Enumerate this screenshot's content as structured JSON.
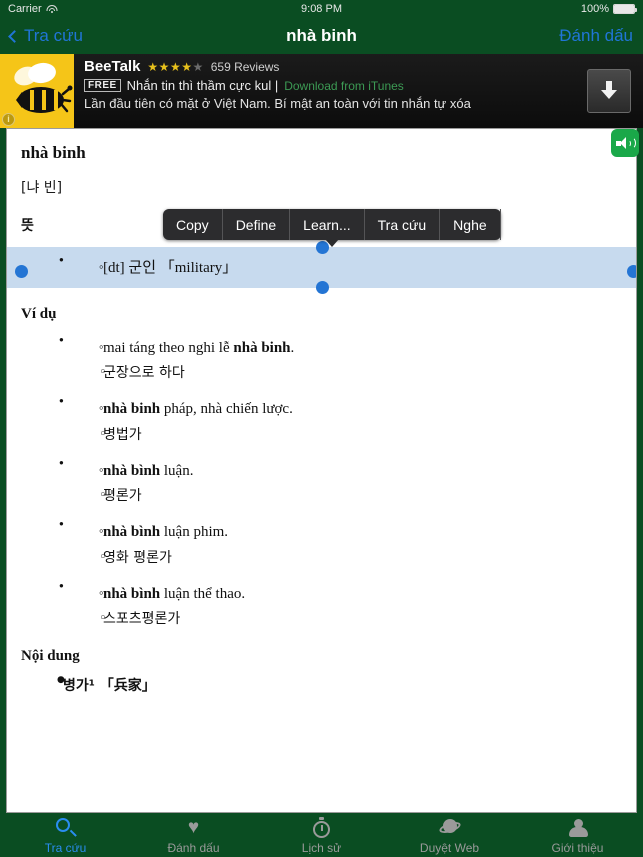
{
  "statusbar": {
    "carrier": "Carrier",
    "wifi_icon": "wifi-icon",
    "time": "9:08 PM",
    "battery_percent": "100%",
    "battery_icon": "battery-full-icon"
  },
  "navbar": {
    "back_label": "Tra cứu",
    "back_icon": "chevron-left-icon",
    "title": "nhà binh",
    "right_label": "Đánh dấu"
  },
  "ad": {
    "app_icon": "beetalk-bee-icon",
    "info_badge": "i",
    "title": "BeeTalk",
    "stars_filled": "★★★★",
    "stars_empty": "★",
    "reviews": "659 Reviews",
    "price_badge": "FREE",
    "tagline": "Nhắn tin thì thầm cực kul |",
    "link": "Download from iTunes",
    "description": "Lần đầu tiên có mặt ở Việt Nam. Bí mật an toàn với tin nhắn tự xóa",
    "download_icon": "download-arrow-icon"
  },
  "speaker_button": {
    "icon": "speaker-volume-icon",
    "color": "#1aa849"
  },
  "context_menu": {
    "items": [
      {
        "label": "Copy"
      },
      {
        "label": "Define"
      },
      {
        "label": "Learn..."
      },
      {
        "label": "Tra cứu"
      },
      {
        "label": "Nghe"
      }
    ]
  },
  "entry": {
    "headword": "nhà binh",
    "pronunciation": "[냐 빈]",
    "meaning_heading": "뜻",
    "selected_definition": "[dt] 군인 「military」",
    "examples_heading": "Ví dụ",
    "examples": [
      {
        "vi_pre": "mai táng theo nghi lễ ",
        "vi_bold": "nhà binh",
        "vi_post": ".",
        "kr": "군장으로 하다"
      },
      {
        "vi_pre": "",
        "vi_bold": "nhà binh",
        "vi_post": " pháp, nhà chiến lược.",
        "kr": "병법가"
      },
      {
        "vi_pre": "",
        "vi_bold": "nhà bình",
        "vi_post": " luận.",
        "kr": "평론가"
      },
      {
        "vi_pre": "",
        "vi_bold": "nhà bình",
        "vi_post": " luận phim.",
        "kr": "영화 평론가"
      },
      {
        "vi_pre": "",
        "vi_bold": "nhà bình",
        "vi_post": " luận thể thao.",
        "kr": "스포츠평론가"
      }
    ],
    "content_heading": "Nội dung",
    "content_items": [
      "병가¹ 「兵家」"
    ]
  },
  "selection": {
    "handle_color": "#2475d4",
    "highlight_color": "#c7daee"
  },
  "tabbar": {
    "items": [
      {
        "label": "Tra cứu",
        "icon": "search-icon",
        "active": true
      },
      {
        "label": "Đánh dấu",
        "icon": "heart-icon",
        "active": false
      },
      {
        "label": "Lịch sử",
        "icon": "stopwatch-icon",
        "active": false
      },
      {
        "label": "Duyệt Web",
        "icon": "globe-icon",
        "active": false
      },
      {
        "label": "Giới thiệu",
        "icon": "person-icon",
        "active": false
      }
    ]
  }
}
